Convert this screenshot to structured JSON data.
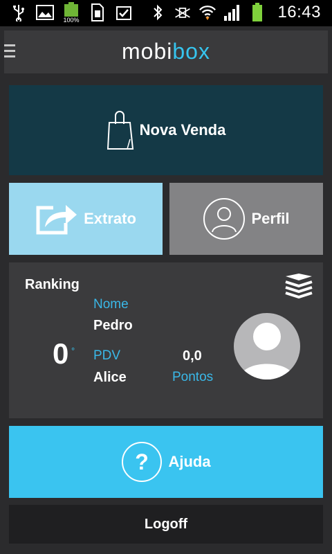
{
  "status_bar": {
    "time": "16:43",
    "battery_percent_label": "100%",
    "left_icons": [
      "usb-icon",
      "gallery-icon",
      "battery-icon",
      "sim-card-icon",
      "task-done-icon"
    ],
    "right_icons": [
      "bluetooth-icon",
      "mute-vibrate-icon",
      "wifi-icon",
      "signal-icon",
      "battery-icon"
    ]
  },
  "header": {
    "logo_part1": "mobi",
    "logo_part2": "box",
    "logo_colors": {
      "mobi": "#ffffff",
      "box": "#36c4ee"
    }
  },
  "tiles": {
    "nova_venda": "Nova Venda",
    "extrato": "Extrato",
    "perfil": "Perfil",
    "ajuda": "Ajuda",
    "logoff": "Logoff"
  },
  "ranking": {
    "title": "Ranking",
    "position": "0",
    "position_suffix": "°",
    "name_label": "Nome",
    "name_value": "Pedro",
    "pdv_label": "PDV",
    "pdv_value": "Alice",
    "points_value": "0,0",
    "points_label": "Pontos"
  },
  "colors": {
    "accent": "#3ac4f0",
    "nova_venda_bg": "#143946",
    "extrato_bg": "#9ad8ef",
    "perfil_bg": "#838385"
  }
}
